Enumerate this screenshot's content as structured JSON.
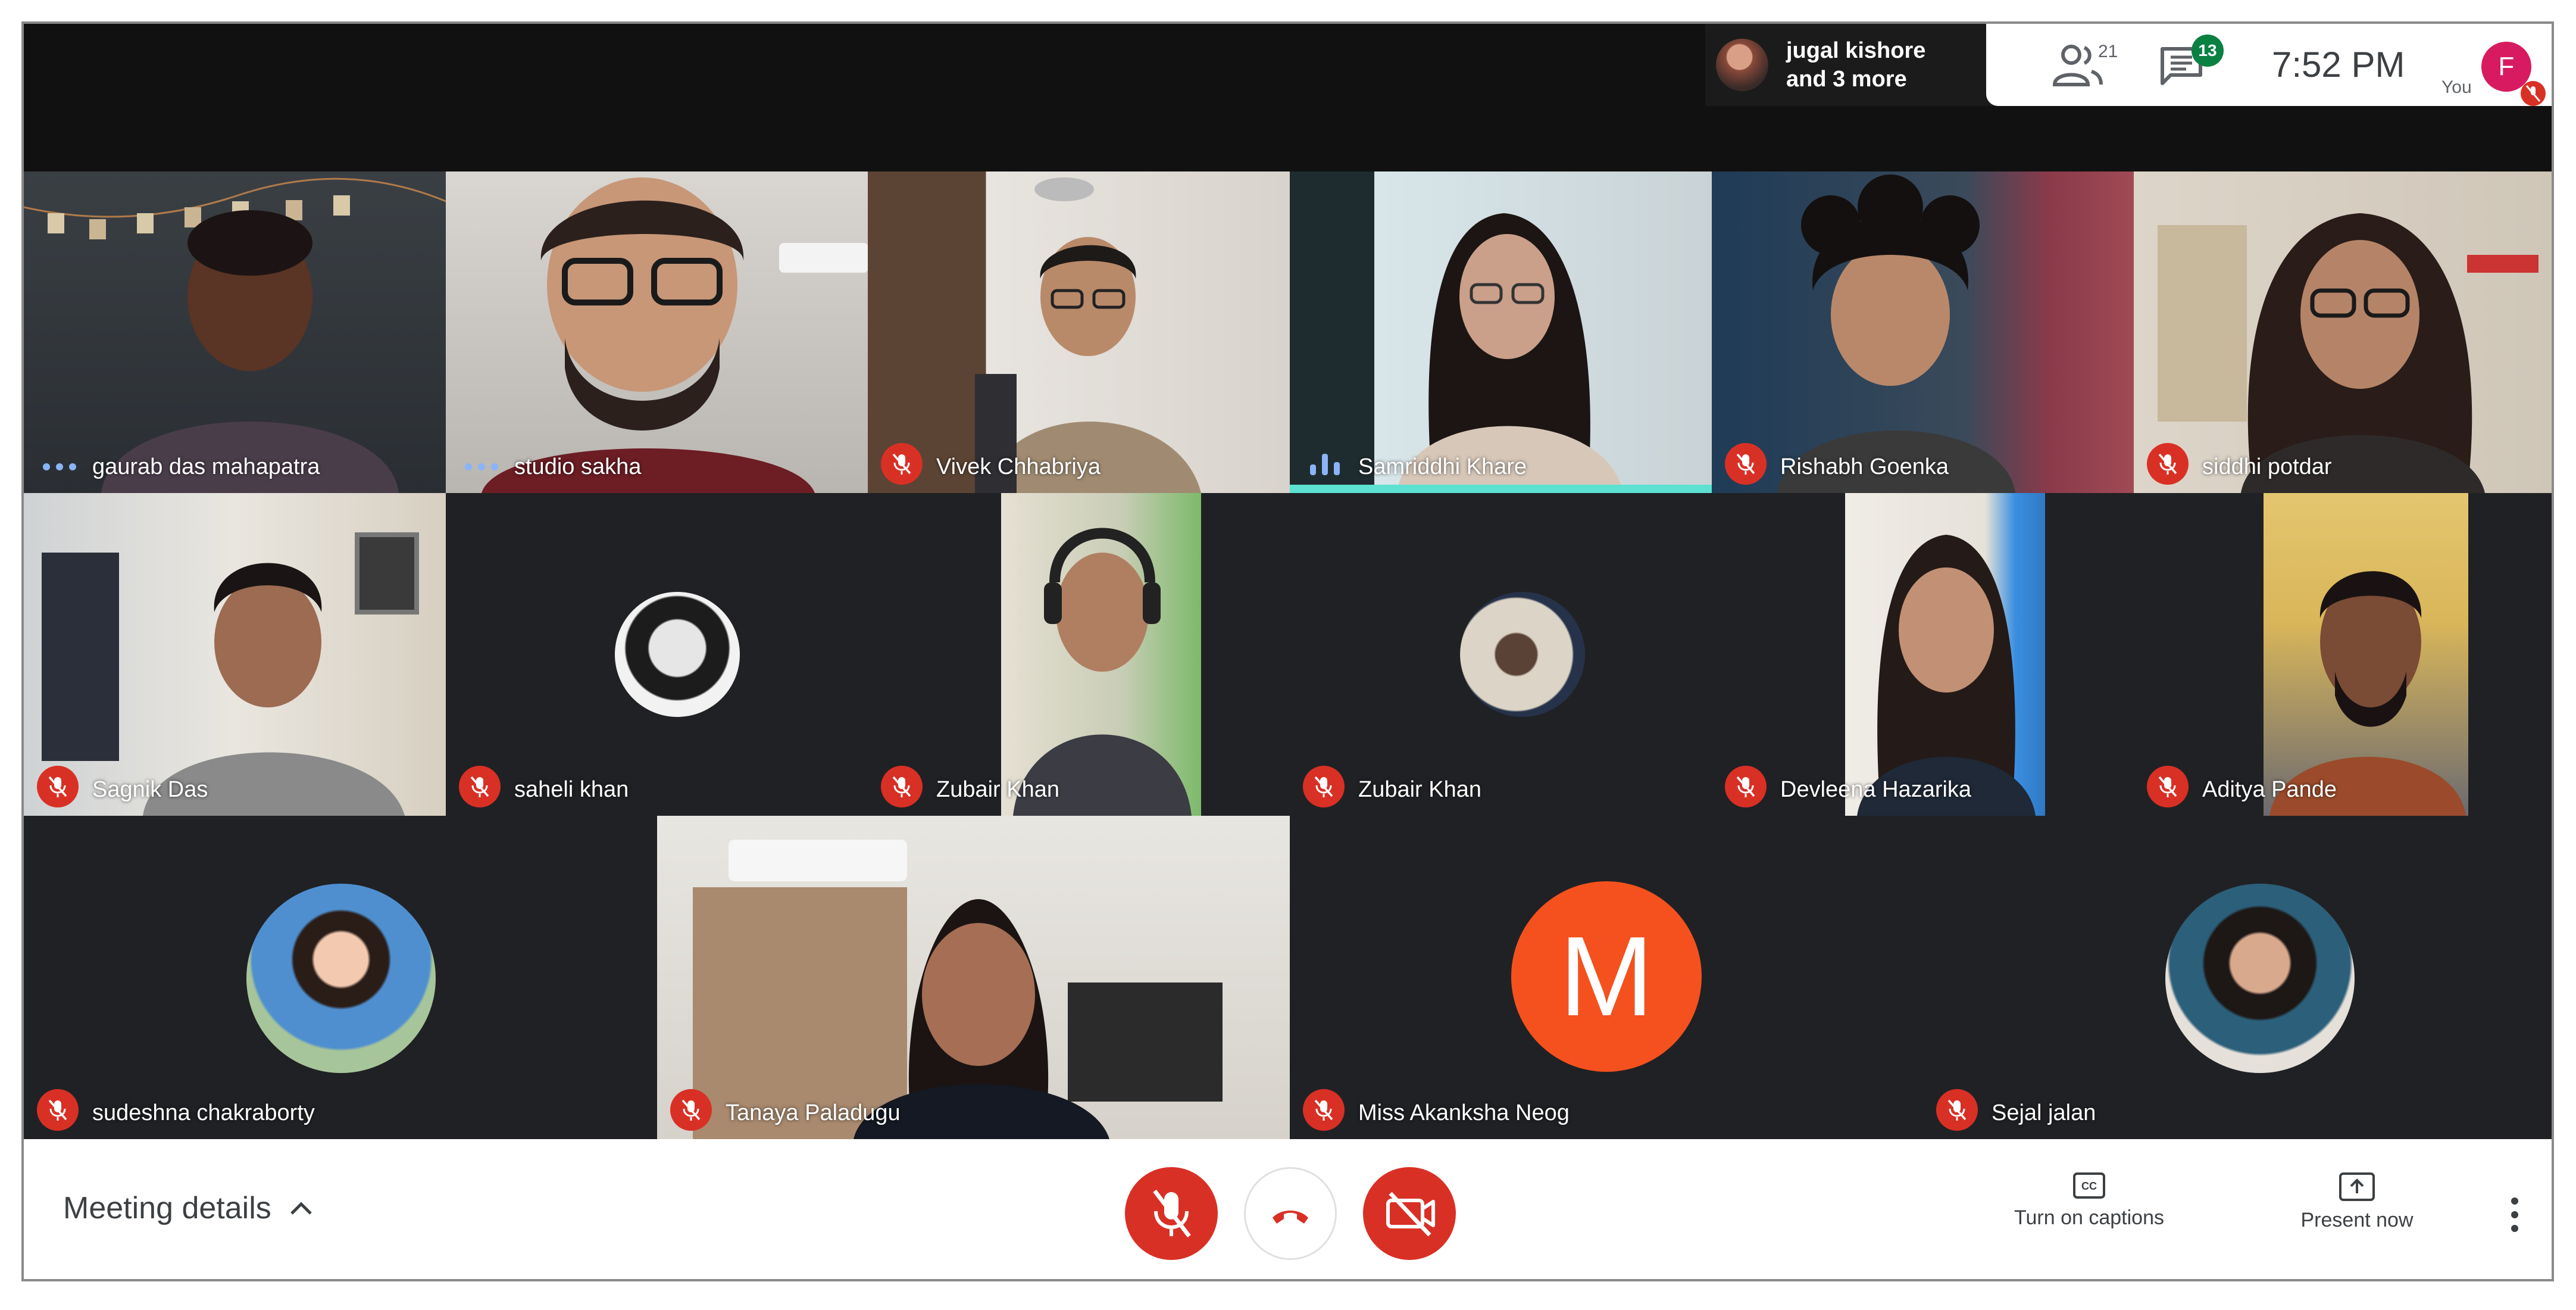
{
  "header": {
    "presenting": {
      "line1": "jugal kishore",
      "line2": "and 3 more"
    },
    "people_count": "21",
    "chat_badge": "13",
    "time": "7:52  PM",
    "self_label": "You",
    "self_avatar_letter": "F"
  },
  "participants": [
    {
      "name": "gaurab das mahapatra",
      "state": "idle"
    },
    {
      "name": "studio sakha",
      "state": "idle"
    },
    {
      "name": "Vivek Chhabriya",
      "state": "muted"
    },
    {
      "name": "Samriddhi Khare",
      "state": "speaking"
    },
    {
      "name": "Rishabh Goenka",
      "state": "muted"
    },
    {
      "name": "siddhi potdar",
      "state": "muted"
    },
    {
      "name": "Sagnik Das",
      "state": "muted"
    },
    {
      "name": "saheli khan",
      "state": "muted"
    },
    {
      "name": "Zubair Khan",
      "state": "muted"
    },
    {
      "name": "Zubair Khan",
      "state": "muted"
    },
    {
      "name": "Devleena Hazarika",
      "state": "muted"
    },
    {
      "name": "Aditya Pande",
      "state": "muted"
    },
    {
      "name": "sudeshna chakraborty",
      "state": "muted"
    },
    {
      "name": "Tanaya Paladugu",
      "state": "muted"
    },
    {
      "name": "Miss Akanksha Neog",
      "state": "muted",
      "avatar_letter": "M"
    },
    {
      "name": "Sejal jalan",
      "state": "muted"
    }
  ],
  "controls": {
    "meeting_details_label": "Meeting details",
    "captions_label": "Turn on captions",
    "present_label": "Present now"
  },
  "colors": {
    "muted_red": "#d93025",
    "speaking_teal": "#5ce1d2",
    "chat_badge_green": "#0b8043",
    "self_avatar_pink": "#d81b60",
    "letter_avatar_orange": "#f4511e",
    "tile_background": "#202124"
  },
  "icons": [
    "people-icon",
    "chat-icon",
    "mic-off-icon",
    "hang-up-icon",
    "camera-off-icon",
    "captions-icon",
    "present-icon",
    "more-vert-icon",
    "chevron-up-icon"
  ]
}
